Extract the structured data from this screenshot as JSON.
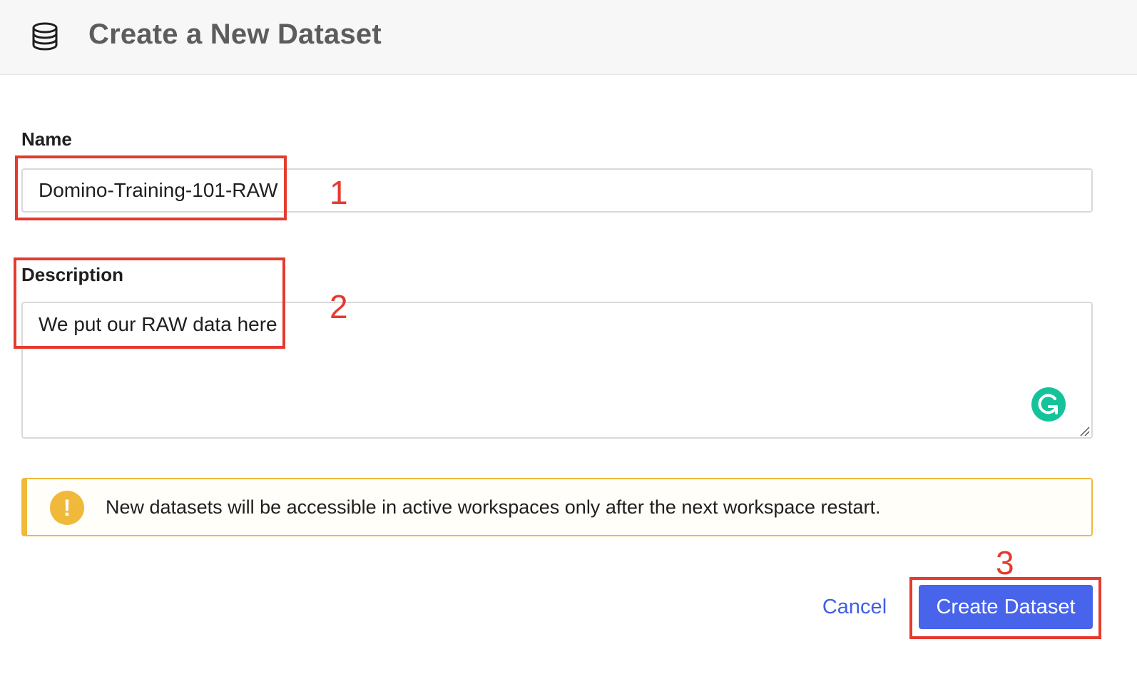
{
  "header": {
    "title": "Create a New Dataset",
    "icon": "database-icon"
  },
  "form": {
    "name_label": "Name",
    "name_value": "Domino-Training-101-RAW",
    "description_label": "Description",
    "description_value": "We put our RAW data here"
  },
  "alert": {
    "icon": "warning-icon",
    "icon_glyph": "!",
    "message": "New datasets will be accessible in active workspaces only after the next workspace restart."
  },
  "actions": {
    "cancel_label": "Cancel",
    "create_label": "Create Dataset"
  },
  "annotations": {
    "step1": "1",
    "step2": "2",
    "step3": "3",
    "color": "#e53a2f"
  },
  "colors": {
    "primary": "#4864ea",
    "link": "#3f5fe6",
    "warning": "#f0b93a",
    "grammarly": "#15c39a"
  }
}
